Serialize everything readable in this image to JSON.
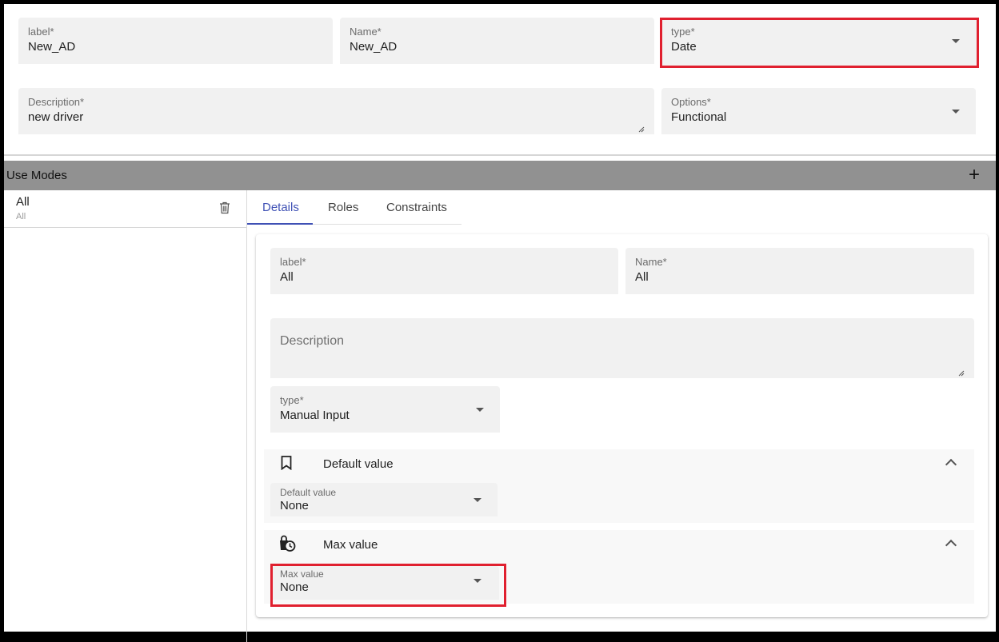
{
  "top_form": {
    "label": {
      "label": "label*",
      "value": "New_AD"
    },
    "name": {
      "label": "Name*",
      "value": "New_AD"
    },
    "type": {
      "label": "type*",
      "value": "Date"
    },
    "description": {
      "label": "Description*",
      "value": "new driver"
    },
    "options": {
      "label": "Options*",
      "value": "Functional"
    }
  },
  "use_modes": {
    "title": "Use Modes",
    "add_icon": "plus-icon",
    "items": [
      {
        "title": "All",
        "subtitle": "All"
      }
    ],
    "delete_icon": "trash-icon"
  },
  "tabs": [
    {
      "label": "Details",
      "active": true
    },
    {
      "label": "Roles",
      "active": false
    },
    {
      "label": "Constraints",
      "active": false
    }
  ],
  "details": {
    "label": {
      "label": "label*",
      "value": "All"
    },
    "name": {
      "label": "Name*",
      "value": "All"
    },
    "description": {
      "placeholder": "Description"
    },
    "type": {
      "label": "type*",
      "value": "Manual Input"
    },
    "default_value_panel": {
      "title": "Default value",
      "icon": "bookmark-icon",
      "field_label": "Default value",
      "field_value": "None"
    },
    "max_value_panel": {
      "title": "Max value",
      "icon": "bag-clock-icon",
      "field_label": "Max value",
      "field_value": "None"
    }
  },
  "colors": {
    "highlight": "#e0202f",
    "accent": "#3f51b5",
    "bar": "#919191"
  }
}
